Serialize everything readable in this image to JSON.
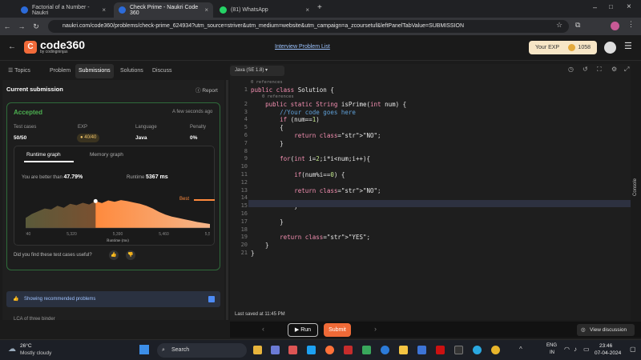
{
  "browser": {
    "tabs": [
      {
        "label": "Factorial of a Number - Naukri",
        "active": false
      },
      {
        "label": "Check Prime - Naukri Code 360",
        "active": true
      },
      {
        "label": "(81) WhatsApp",
        "active": false
      }
    ],
    "new_tab_label": "+",
    "url": "naukri.com/code360/problems/check-prime_624934?utm_source=striver&utm_medium=website&utm_campaign=a_zcoursetuf&leftPanelTabValue=SUBMISSION"
  },
  "header": {
    "logo_main": "code360",
    "logo_sub": "by codingninjas",
    "problem_list_link": "Interview Problem List",
    "exp_label": "Your EXP",
    "exp_value": "1058"
  },
  "left_tabs": {
    "topics": "Topics",
    "problem": "Problem",
    "submissions": "Submissions",
    "solutions": "Solutions",
    "discuss": "Discuss"
  },
  "submission": {
    "title": "Current submission",
    "report": "Report",
    "status": "Accepted",
    "time": "A few seconds ago",
    "test_cases_label": "Test cases",
    "test_cases_value": "50/50",
    "exp_label": "EXP",
    "exp_value": "40/40",
    "language_label": "Language",
    "language_value": "Java",
    "penalty_label": "Penalty",
    "penalty_value": "0%",
    "graph_tabs": [
      "Runtime graph",
      "Memory graph"
    ],
    "better_than_label": "You are better than",
    "better_than_value": "47.79%",
    "runtime_label": "Runtime",
    "runtime_value": "5367 ms",
    "best_label": "Best",
    "feedback_question": "Did you find these test cases useful?",
    "recommended": "Showing recommended problems",
    "next_item": "LCA of three binder"
  },
  "chart_data": {
    "type": "area",
    "x_ticks": [
      "5,240",
      "5,320",
      "5,390",
      "5,460",
      "5,510"
    ],
    "xlabel": "Runtime (ms)",
    "marker_x": "5,367",
    "series": [
      {
        "values": [
          0.3,
          0.42,
          0.5,
          0.58,
          0.55,
          0.66,
          0.6,
          0.72,
          0.68,
          0.75,
          0.7,
          0.8,
          0.74,
          0.82,
          0.78,
          0.83,
          0.8,
          0.76,
          0.72,
          0.66,
          0.58,
          0.48,
          0.4,
          0.34,
          0.3,
          0.26,
          0.22,
          0.18,
          0.15,
          0.12
        ]
      }
    ]
  },
  "editor": {
    "language": "Java (SE 1.8)",
    "last_saved": "Last saved at 11:45 PM",
    "run": "Run",
    "submit": "Submit",
    "view_discussion": "View discussion",
    "console": "Console",
    "lines": [
      {
        "n": "1",
        "text": "public class Solution {"
      },
      {
        "n": "2",
        "text": "    public static String isPrime(int num) {"
      },
      {
        "n": "3",
        "text": "        //Your code goes here"
      },
      {
        "n": "4",
        "text": "        if (num==1)"
      },
      {
        "n": "5",
        "text": "        {"
      },
      {
        "n": "6",
        "text": "            return \"NO\";"
      },
      {
        "n": "7",
        "text": "        }"
      },
      {
        "n": "8",
        "text": ""
      },
      {
        "n": "9",
        "text": "        for(int i=2;i*i<num;i++){"
      },
      {
        "n": "10",
        "text": ""
      },
      {
        "n": "11",
        "text": "            if(num%i==0) {"
      },
      {
        "n": "12",
        "text": ""
      },
      {
        "n": "13",
        "text": "            return \"NO\";"
      },
      {
        "n": "14",
        "text": ""
      },
      {
        "n": "15",
        "text": "            }"
      },
      {
        "n": "16",
        "text": ""
      },
      {
        "n": "17",
        "text": "        }"
      },
      {
        "n": "18",
        "text": ""
      },
      {
        "n": "19",
        "text": "        return \"YES\";"
      },
      {
        "n": "20",
        "text": "    }"
      },
      {
        "n": "21",
        "text": "}"
      }
    ],
    "refs": "0 references"
  },
  "taskbar": {
    "weather_temp": "26°C",
    "weather_desc": "Mostly cloudy",
    "search": "Search",
    "lang": "ENG",
    "region": "IN",
    "time": "23:46",
    "date": "07-04-2024"
  }
}
